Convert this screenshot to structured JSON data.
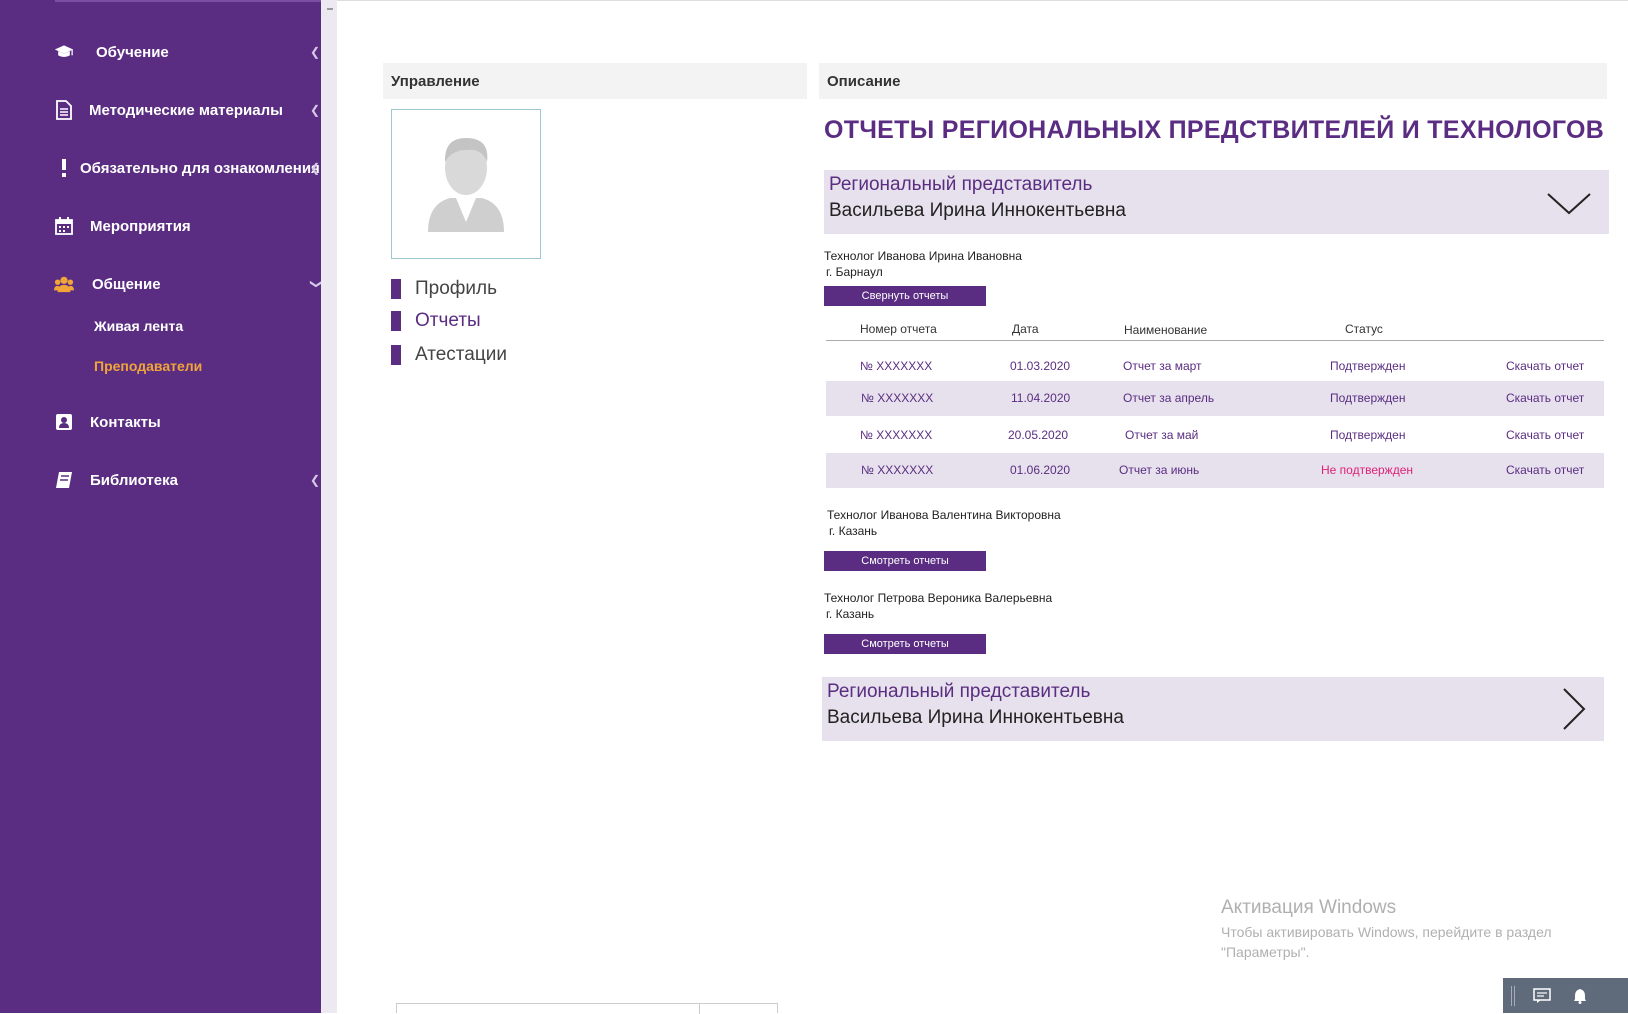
{
  "sidebar": {
    "items": [
      {
        "label": "Обучение",
        "icon": "graduation-cap-icon"
      },
      {
        "label": "Методические материалы",
        "icon": "document-icon"
      },
      {
        "label": "Обязательно для ознакомления",
        "icon": "exclamation-icon"
      },
      {
        "label": "Мероприятия",
        "icon": "calendar-icon"
      },
      {
        "label": "Общение",
        "icon": "users-icon"
      },
      {
        "label": "Контакты",
        "icon": "contact-card-icon"
      },
      {
        "label": "Библиотека",
        "icon": "book-icon"
      }
    ],
    "sub_items": [
      {
        "label": "Живая лента"
      },
      {
        "label": "Преподаватели"
      }
    ],
    "bg_color": "#5a2d82",
    "active_color": "#f0a43a"
  },
  "left_panel": {
    "header": "Управление",
    "menu": [
      {
        "label": "Профиль"
      },
      {
        "label": "Отчеты"
      },
      {
        "label": "Атестации"
      }
    ]
  },
  "right_panel": {
    "header": "Описание",
    "title": "ОТЧЕТЫ РЕГИОНАЛЬНЫХ ПРЕДСТВИТЕЛЕЙ И ТЕХНОЛОГОВ",
    "rep1": {
      "role": "Региональный представитель",
      "name": "Васильева Ирина Иннокентьевна"
    },
    "rep2": {
      "role": "Региональный представитель",
      "name": "Васильева Ирина Иннокентьевна"
    },
    "technologists": [
      {
        "line1": "Технолог  Иванова Ирина Ивановна",
        "line2": "г. Барнаул",
        "button": "Свернуть отчеты"
      },
      {
        "line1": "Технолог  Иванова Валентина Викторовна",
        "line2": "г. Казань",
        "button": "Смотреть отчеты"
      },
      {
        "line1": "Технолог  Петрова Вероника Валерьевна",
        "line2": "г. Казань",
        "button": "Смотреть отчеты"
      }
    ],
    "table": {
      "headers": [
        "Номер отчета",
        "Дата",
        "Наименование",
        "Статус"
      ],
      "rows": [
        {
          "num": "№ XXXXXXX",
          "date": "01.03.2020",
          "name": "Отчет за март",
          "status": "Подтвержден",
          "action": "Скачать отчет"
        },
        {
          "num": "№ XXXXXXX",
          "date": "11.04.2020",
          "name": "Отчет за апрель",
          "status": "Подтвержден",
          "action": "Скачать отчет"
        },
        {
          "num": "№ XXXXXXX",
          "date": "20.05.2020",
          "name": "Отчет за май",
          "status": "Подтвержден",
          "action": "Скачать отчет"
        },
        {
          "num": "№ XXXXXXX",
          "date": "01.06.2020",
          "name": "Отчет за июнь",
          "status": "Не подтвержден",
          "action": "Скачать отчет"
        }
      ]
    }
  },
  "watermark": {
    "line1": "Активация Windows",
    "line2": "Чтобы активировать Windows, перейдите в раздел",
    "line3": "\"Параметры\"."
  },
  "taskbar": {
    "icons": [
      "chat-icon",
      "bell-icon"
    ]
  }
}
